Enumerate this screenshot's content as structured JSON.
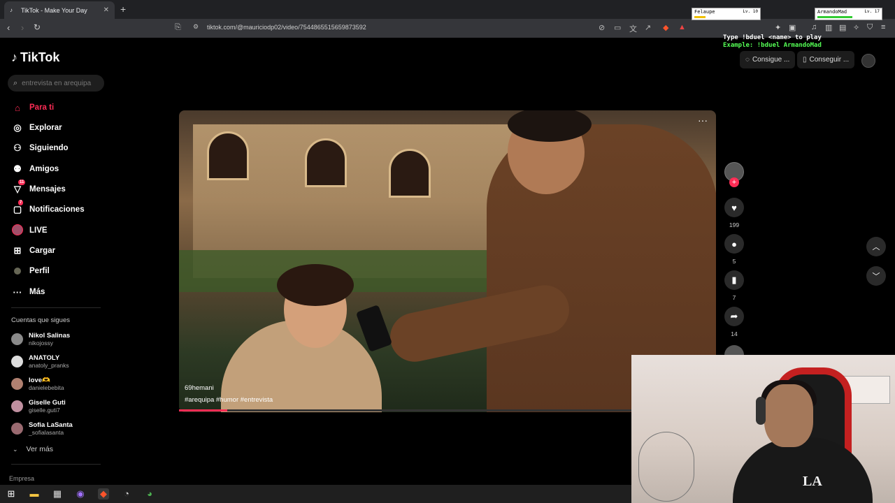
{
  "browser": {
    "tab_title": "TikTok - Make Your Day",
    "url": "tiktok.com/@mauriciodp02/video/7544865515659873592"
  },
  "overlay": {
    "player1_name": "Felaupe",
    "player1_level": "Lv. 10",
    "player2_name": "ArmandoMad",
    "player2_level": "Lv. 17",
    "command_line1": "Type !bduel <name> to play",
    "command_line2": "Example: !bduel ArmandoMad"
  },
  "tiktok": {
    "logo": "TikTok",
    "search_placeholder": "entrevista en arequipa",
    "menu": [
      {
        "label": "Para ti",
        "icon": "home-icon"
      },
      {
        "label": "Explorar",
        "icon": "compass-icon"
      },
      {
        "label": "Siguiendo",
        "icon": "following-icon"
      },
      {
        "label": "Amigos",
        "icon": "friends-icon"
      },
      {
        "label": "Mensajes",
        "icon": "messages-icon",
        "badge": "11"
      },
      {
        "label": "Notificaciones",
        "icon": "notifications-icon",
        "badge": "7"
      },
      {
        "label": "LIVE",
        "icon": "live-icon"
      },
      {
        "label": "Cargar",
        "icon": "upload-icon"
      },
      {
        "label": "Perfil",
        "icon": "profile-icon"
      },
      {
        "label": "Más",
        "icon": "more-icon"
      }
    ],
    "following_title": "Cuentas que sigues",
    "following": [
      {
        "name": "Nikol Salinas",
        "handle": "nikojossy"
      },
      {
        "name": "ANATOLY",
        "handle": "anatoly_pranks"
      },
      {
        "name": "love🫶",
        "handle": "danielebebita"
      },
      {
        "name": "Giselle Guti",
        "handle": "giselle.guti7"
      },
      {
        "name": "Sofia LaSanta",
        "handle": "_sofialasanta"
      }
    ],
    "see_more": "Ver más",
    "footer": "Empresa",
    "header_buttons": [
      "Consigue ...",
      "Conseguir ..."
    ],
    "video": {
      "author": "69hemani",
      "tags": "#arequipa  #humor  #entrevista",
      "progress": 0.09
    },
    "actions": {
      "likes": "199",
      "comments": "5",
      "saves": "7",
      "shares": "14"
    }
  },
  "colors": {
    "accent": "#fe2c55",
    "background": "#000000"
  }
}
